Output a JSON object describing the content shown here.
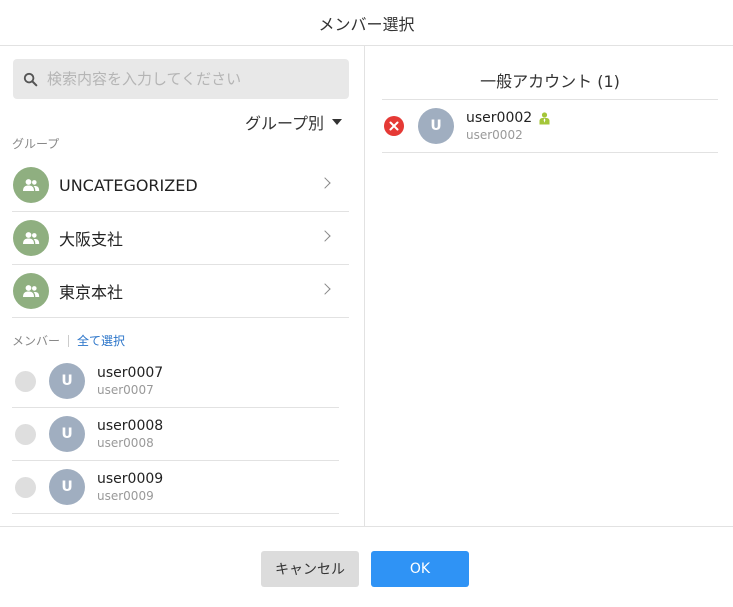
{
  "dialog": {
    "title": "メンバー選択"
  },
  "search": {
    "placeholder": "検索内容を入力してください",
    "value": ""
  },
  "grouping": {
    "label": "グループ別"
  },
  "groups_section": {
    "label": "グループ",
    "items": [
      {
        "name": "UNCATEGORIZED"
      },
      {
        "name": "大阪支社"
      },
      {
        "name": "東京本社"
      }
    ]
  },
  "members_section": {
    "label": "メンバー",
    "select_all": "全て選択",
    "items": [
      {
        "initial": "U",
        "name": "user0007",
        "sub": "user0007"
      },
      {
        "initial": "U",
        "name": "user0008",
        "sub": "user0008"
      },
      {
        "initial": "U",
        "name": "user0009",
        "sub": "user0009"
      }
    ]
  },
  "selected": {
    "title": "一般アカウント (1)",
    "items": [
      {
        "initial": "U",
        "name": "user0002",
        "sub": "user0002"
      }
    ]
  },
  "footer": {
    "cancel_label": "キャンセル",
    "ok_label": "OK"
  },
  "colors": {
    "primary": "#2f93f5",
    "group_avatar": "#8faf80",
    "user_avatar": "#a0aec0",
    "remove": "#e53935",
    "person_badge": "#a4c639"
  }
}
